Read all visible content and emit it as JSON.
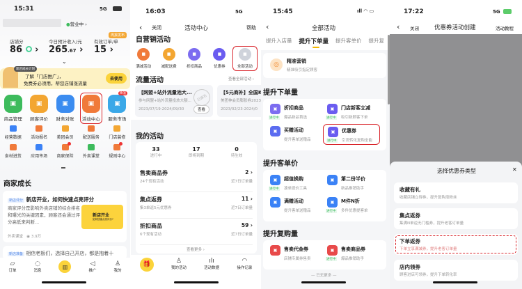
{
  "p1": {
    "time": "15:31",
    "signal": "5G",
    "status_badge": "营业中",
    "stats": [
      {
        "label": "店铺分",
        "value": "86"
      },
      {
        "label": "今日预计收入/元",
        "value": "265",
        "decimal": ".67"
      },
      {
        "label": "有效订单/单",
        "value": "15"
      }
    ],
    "corner_tag": "周报发布",
    "banner": {
      "tag": "新店成长计划",
      "line1": "了解「门店推广」，",
      "line2": "免费券必须用，帮您店铺涨流量",
      "button": "去使用"
    },
    "main_icons": [
      {
        "label": "商品管理",
        "color": "#3dbb5c"
      },
      {
        "label": "顾客评价",
        "color": "#f3a632"
      },
      {
        "label": "财务对账",
        "color": "#3b8cf0"
      },
      {
        "label": "活动中心",
        "color": "#f07a3a"
      },
      {
        "label": "服务市场",
        "color": "#3aa8e8",
        "badge": "降温"
      }
    ],
    "small_icons_row1": [
      {
        "label": "经营数据",
        "color": "#3b82f6"
      },
      {
        "label": "活动报名",
        "color": "#f07a3a"
      },
      {
        "label": "美团会员",
        "color": "#f3a632"
      },
      {
        "label": "配送服务",
        "color": "#f07a3a"
      },
      {
        "label": "门店装修",
        "color": "#f3a632"
      }
    ],
    "small_icons_row2": [
      {
        "label": "食材进货",
        "color": "#f07a3a"
      },
      {
        "label": "应用市场",
        "color": "#3b82f6"
      },
      {
        "label": "商家保险",
        "color": "#f07a3a",
        "badge": "1"
      },
      {
        "label": "外卖课堂",
        "color": "#3dbb5c"
      },
      {
        "label": "规则中心",
        "color": "#f07a3a",
        "badge": "1"
      }
    ],
    "section_title": "商家成长",
    "article1": {
      "tag": "新店评分",
      "title": "新店开业，如何快速点亮评分",
      "body": "商家评分是影响外卖店铺的综合排名和曝光的关键因素，顾客还会通过评分高低来判断...",
      "source": "外卖课堂",
      "views": "3.9万",
      "thumb_title": "新店开业",
      "thumb_sub": "如何快速点亮评分?"
    },
    "article2": {
      "tag": "新店准备",
      "title": "相信老板们，选择自己开店，都是抱着十"
    },
    "tabs": [
      "订单",
      "消息",
      "",
      "推广",
      "我的"
    ]
  },
  "p2": {
    "time": "16:03",
    "signal": "5G",
    "nav": {
      "close": "关闭",
      "title": "活动中心",
      "help": "帮助"
    },
    "section1": "自营销活动",
    "marketing_icons": [
      {
        "label": "满减活动",
        "color": "#f07a3a"
      },
      {
        "label": "减配送费",
        "color": "#f3a632"
      },
      {
        "label": "折扣商品",
        "color": "#7c6cf0"
      },
      {
        "label": "优惠券",
        "color": "#6a5cf0"
      },
      {
        "label": "全部活动",
        "color": "#cfd3db"
      }
    ],
    "section2": "流量活动",
    "view_all": "查看全部活动",
    "traffic_cards": [
      {
        "title": "【网盟+站外流量池大...",
        "sub": "参与网盟+站外流量投放大额...",
        "date": "2023/07/19-2024/09/30",
        "button": "查看",
        "stamp": "已报名"
      },
      {
        "title": "【5元商补】全国K",
        "sub": "美团神会员膨胀券2023",
        "date": "2023/02/23-2024/0"
      }
    ],
    "section3": "我的活动",
    "counts": [
      {
        "value": "33",
        "label": "进行中"
      },
      {
        "value": "17",
        "label": "即将到期"
      },
      {
        "value": "0",
        "label": "待生效"
      }
    ],
    "rows": [
      {
        "title": "售卖商品券",
        "sub": "24个现有活动",
        "value": "2",
        "metric": "近7日订单量"
      },
      {
        "title": "集点返券",
        "sub": "集3单返5元优惠券",
        "value": "11",
        "metric": "近7日订单量"
      },
      {
        "title": "折扣商品",
        "sub": "6个现有活动",
        "value": "59",
        "metric": "近7日订单量"
      }
    ],
    "more": "查看更多",
    "tabs": [
      "",
      "我的活动",
      "活动数据",
      "操作记录"
    ]
  },
  "p3": {
    "time": "15:45",
    "nav_title": "全部活动",
    "tabs": [
      "提升入店量",
      "提升下单量",
      "提升客单价",
      "提升复"
    ],
    "active_tab": 1,
    "top_item": {
      "title": "精准营销",
      "sub": "精准吸引指定顾客"
    },
    "groups": [
      {
        "title": "提升下单量",
        "items": [
          {
            "title": "折扣商品",
            "sub": "爆品新品首选",
            "running": true,
            "color": "#7c6cf0"
          },
          {
            "title": "门店新客立减",
            "sub": "吸引新顾客下单",
            "running": true,
            "color": "#6a5cf0"
          },
          {
            "title": "买赠活动",
            "sub": "提升客单送赠品",
            "running": false,
            "color": "#5b6cf0"
          },
          {
            "title": "优惠券",
            "sub": "引流转化复购全能",
            "running": true,
            "color": "#6a5cf0",
            "highlight": true
          }
        ]
      },
      {
        "title": "提升客单价",
        "items": [
          {
            "title": "超值换购",
            "sub": "凑单提价工具",
            "running": true,
            "color": "#3b82f6"
          },
          {
            "title": "第二份半价",
            "sub": "新品推销助手",
            "running": false,
            "color": "#3b82f6"
          },
          {
            "title": "满赠活动",
            "sub": "提升客单送赠品",
            "running": false,
            "color": "#3b82f6"
          },
          {
            "title": "M件N折",
            "sub": "多件优惠提客单",
            "running": true,
            "color": "#3b82f6"
          }
        ]
      },
      {
        "title": "提升复购量",
        "items": [
          {
            "title": "售卖代金券",
            "sub": "店铺专属券售卖",
            "running": false,
            "color": "#e84a4a"
          },
          {
            "title": "售卖商品券",
            "sub": "爆品推销助手",
            "running": true,
            "color": "#e84a4a"
          }
        ]
      }
    ],
    "running_label": "进行中",
    "end_text": "— 已无更多 —"
  },
  "p4": {
    "time": "17:22",
    "signal": "5G",
    "nav": {
      "close": "关闭",
      "title": "优惠券活动创建",
      "tutorial": "活动教程"
    },
    "sheet_title": "选择优惠券类型",
    "options": [
      {
        "title": "收藏有礼",
        "sub": "收藏店铺立得券，提升复购涨粉丝"
      },
      {
        "title": "集点返券",
        "sub": "集满N单返无门槛券，提升老客订单量"
      },
      {
        "title": "下单返券",
        "sub": "下单立享满减券，提升老客订单量",
        "highlight": true
      },
      {
        "title": "店内领券",
        "sub": "顾客进店可领券，提升下单转化率"
      }
    ]
  }
}
